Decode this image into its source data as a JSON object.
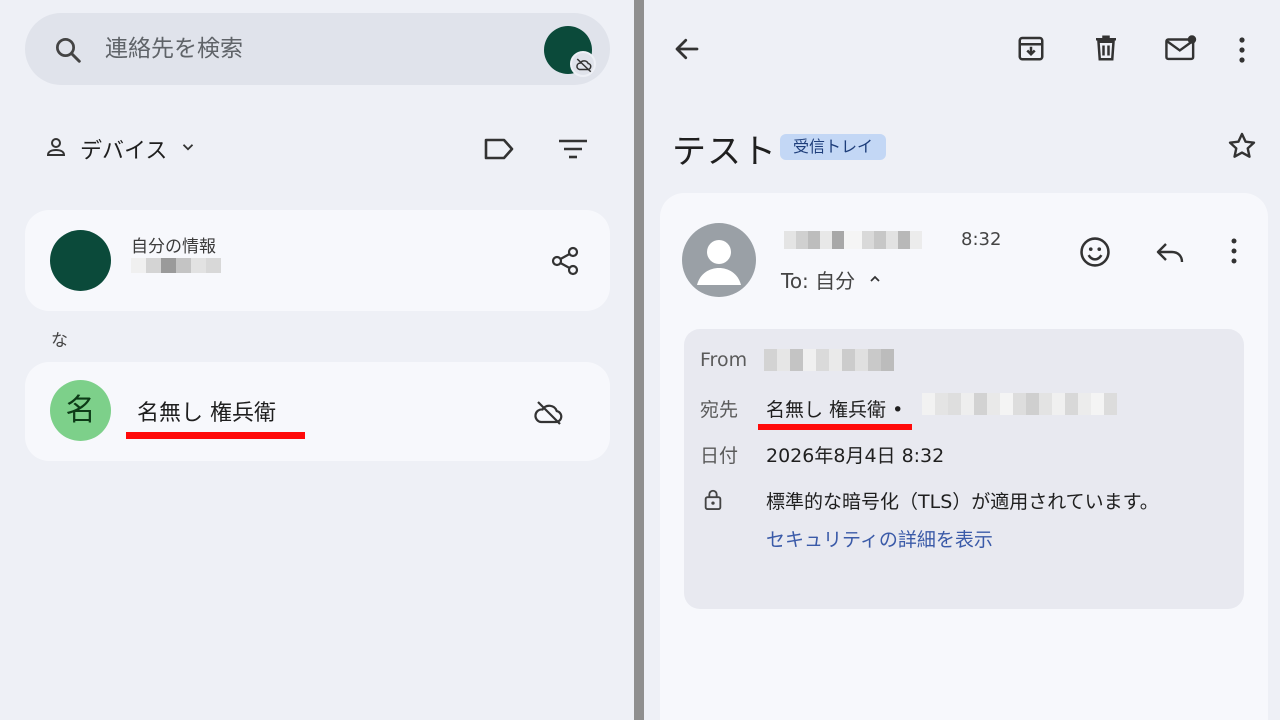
{
  "contacts_pane": {
    "search": {
      "placeholder": "連絡先を検索"
    },
    "filter": {
      "device_label": "デバイス"
    },
    "my_info": {
      "title": "自分の情報"
    },
    "section_letter": "な",
    "contact": {
      "avatar_letter": "名",
      "name": "名無し 権兵衛"
    }
  },
  "mail_pane": {
    "subject": "テスト",
    "label_chip": "受信トレイ",
    "message": {
      "time": "8:32",
      "to_label": "To: 自分"
    },
    "details": {
      "from_key": "From",
      "to_key": "宛先",
      "to_value": "名無し 権兵衛 •",
      "date_key": "日付",
      "date_value": "2026年8月4日 8:32",
      "encryption_text": "標準的な暗号化（TLS）が適用されています。",
      "security_link": "セキュリティの詳細を表示"
    }
  },
  "colors": {
    "background": "#eef0f6",
    "card": "#f7f8fc",
    "dark_avatar": "#0b4a3a",
    "contact_avatar": "#7dd08a",
    "chip": "#c3d7f5",
    "underline": "#ff0a0a",
    "divider": "#8f8f8f"
  },
  "icons": [
    "search-icon",
    "cloud-off-icon",
    "person-icon",
    "chevron-down-icon",
    "label-icon",
    "filter-icon",
    "share-icon",
    "back-arrow-icon",
    "archive-icon",
    "delete-icon",
    "mark-unread-icon",
    "more-vert-icon",
    "star-icon",
    "emoji-icon",
    "reply-icon",
    "lock-icon"
  ]
}
